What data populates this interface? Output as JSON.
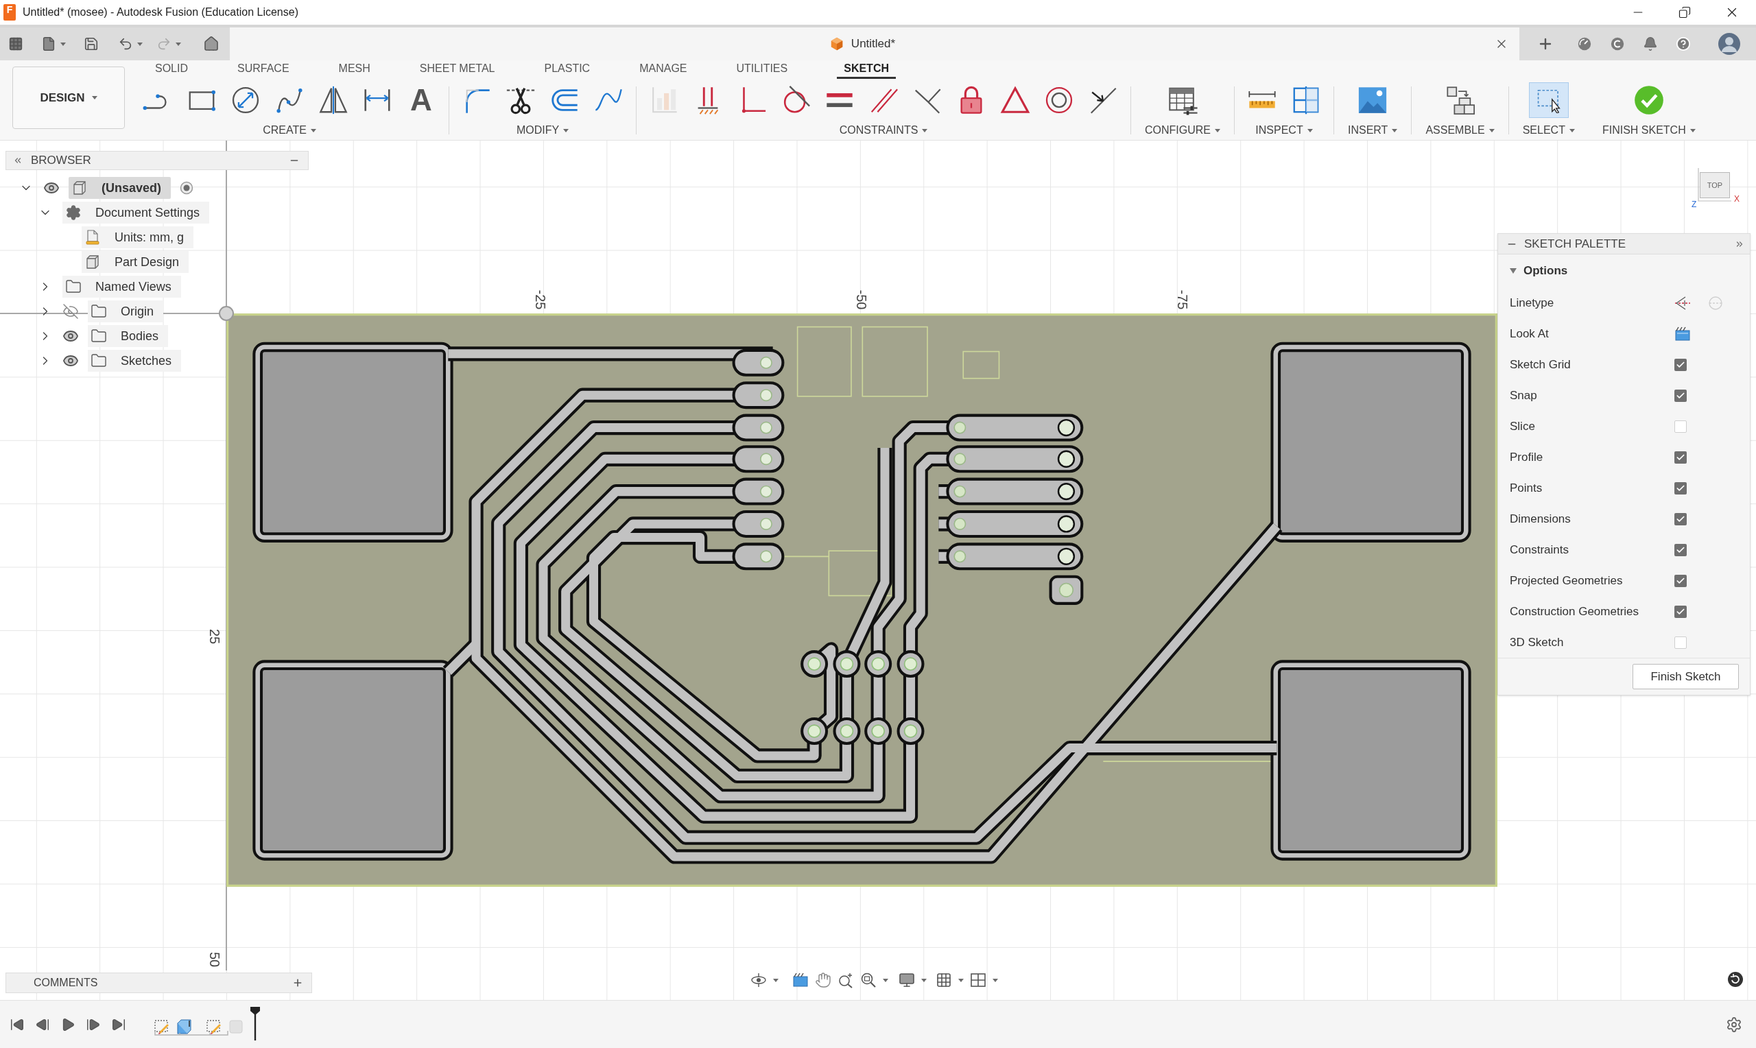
{
  "window": {
    "app_icon_letter": "F",
    "title": "Untitled* (mosee) - Autodesk Fusion (Education License)"
  },
  "document_tab": {
    "title": "Untitled*"
  },
  "workspace_button": {
    "label": "DESIGN"
  },
  "tabs": [
    {
      "label": "SOLID",
      "selected": false
    },
    {
      "label": "SURFACE",
      "selected": false
    },
    {
      "label": "MESH",
      "selected": false
    },
    {
      "label": "SHEET METAL",
      "selected": false
    },
    {
      "label": "PLASTIC",
      "selected": false
    },
    {
      "label": "MANAGE",
      "selected": false
    },
    {
      "label": "UTILITIES",
      "selected": false
    },
    {
      "label": "SKETCH",
      "selected": true
    }
  ],
  "tool_groups": [
    {
      "label": "CREATE",
      "selected": false,
      "glyph": "A"
    },
    {
      "label": "MODIFY",
      "selected": false
    },
    {
      "label": "CONSTRAINTS",
      "selected": false
    },
    {
      "label": "CONFIGURE",
      "selected": false
    },
    {
      "label": "INSPECT",
      "selected": false
    },
    {
      "label": "INSERT",
      "selected": false
    },
    {
      "label": "ASSEMBLE",
      "selected": false
    },
    {
      "label": "SELECT",
      "selected": true
    },
    {
      "label": "FINISH SKETCH",
      "selected": false
    }
  ],
  "browser": {
    "title": "BROWSER",
    "items": [
      {
        "label": "(Unsaved)",
        "kind": "component",
        "visible": true,
        "selected": true,
        "active": true,
        "expanded": true,
        "children": [
          {
            "label": "Document Settings",
            "kind": "settings",
            "selected": false,
            "expanded": true,
            "children": [
              {
                "label": "Units: mm, g",
                "kind": "units",
                "selected": false
              },
              {
                "label": "Part Design",
                "kind": "design",
                "selected": false
              }
            ]
          },
          {
            "label": "Named Views",
            "kind": "folder",
            "selected": false,
            "expanded": false
          },
          {
            "label": "Origin",
            "kind": "folder",
            "visible": false,
            "selected": false,
            "expanded": false
          },
          {
            "label": "Bodies",
            "kind": "folder",
            "visible": true,
            "selected": false,
            "expanded": false
          },
          {
            "label": "Sketches",
            "kind": "folder",
            "visible": true,
            "selected": false,
            "expanded": false
          }
        ]
      }
    ]
  },
  "canvas": {
    "axis_labels": [
      {
        "text": "-25",
        "kind": "x"
      },
      {
        "text": "-50",
        "kind": "x"
      },
      {
        "text": "-75",
        "kind": "x"
      },
      {
        "text": "25",
        "kind": "y"
      },
      {
        "text": "50",
        "kind": "y"
      }
    ],
    "view_cube": {
      "face": "TOP",
      "axes": [
        {
          "letter": "Z",
          "color": "#2f6fd6"
        },
        {
          "letter": "X",
          "color": "#d23a3a"
        }
      ]
    }
  },
  "sketch_palette": {
    "title": "SKETCH PALETTE",
    "section": {
      "title": "Options",
      "expanded": true
    },
    "rows": [
      {
        "kind": "linetype",
        "label": "Linetype"
      },
      {
        "kind": "action",
        "label": "Look At"
      },
      {
        "kind": "checkbox",
        "label": "Sketch Grid",
        "checked": true
      },
      {
        "kind": "checkbox",
        "label": "Snap",
        "checked": true
      },
      {
        "kind": "checkbox",
        "label": "Slice",
        "checked": false
      },
      {
        "kind": "checkbox",
        "label": "Profile",
        "checked": true
      },
      {
        "kind": "checkbox",
        "label": "Points",
        "checked": true
      },
      {
        "kind": "checkbox",
        "label": "Dimensions",
        "checked": true
      },
      {
        "kind": "checkbox",
        "label": "Constraints",
        "checked": true
      },
      {
        "kind": "checkbox",
        "label": "Projected Geometries",
        "checked": true
      },
      {
        "kind": "checkbox",
        "label": "Construction Geometries",
        "checked": true
      },
      {
        "kind": "checkbox",
        "label": "3D Sketch",
        "checked": false
      }
    ],
    "button": "Finish Sketch"
  },
  "comments": {
    "title": "COMMENTS"
  }
}
